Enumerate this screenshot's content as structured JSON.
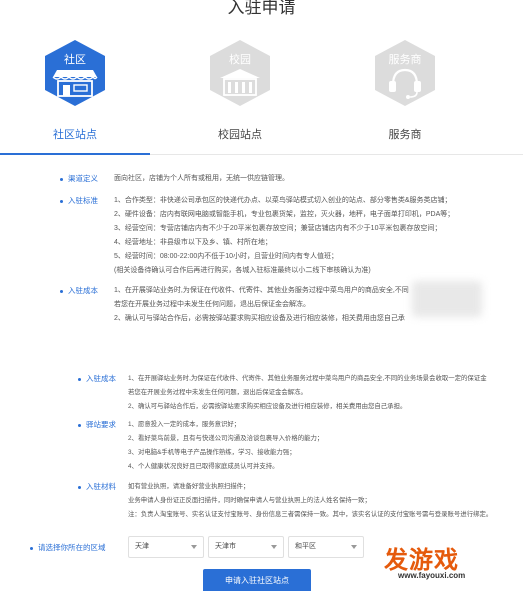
{
  "page": {
    "title": "入驻申请"
  },
  "tabs": [
    {
      "icon_text": "社区",
      "label": "社区站点",
      "active": true,
      "icon": "storefront-icon"
    },
    {
      "icon_text": "校园",
      "label": "校园站点",
      "active": false,
      "icon": "school-icon"
    },
    {
      "icon_text": "服务商",
      "label": "服务商",
      "active": false,
      "icon": "headset-icon"
    }
  ],
  "sections": {
    "channel": {
      "label": "渠道定义",
      "lines": [
        "面向社区，店铺为个人所有或租用，无统一供应链管理。"
      ]
    },
    "standard": {
      "label": "入驻标准",
      "lines": [
        "1、合作类型：非快递公司承包区的快递代办点、以菜鸟驿站模式切入创业的站点、部分零售类&服务类店铺；",
        "2、硬件设备：店内有联网电脑或智能手机，专业包裹货架，监控，灭火器，地秤，电子面单打印机，PDA等；",
        "3、经营空间：专营店铺店内有不少于20平米包裹存放空间；兼营店铺店内有不少于10平米包裹存放空间；",
        "4、经营地址：非县级市以下及乡、镇、村所在地；",
        "5、经营时间：08:00-22:00内不低于10小时，且营业时间内有专人值班；",
        "(相关设备待确认可合作后再进行购买，各城入驻标准最终以小二线下审核确认为准)"
      ]
    },
    "cost1": {
      "label": "入驻成本",
      "lines": [
        "1、在开展驿站业务时,为保证在代收件、代寄件、其他业务服务过程中菜鸟用户的商品安全,不同",
        "若您在开展业务过程中未发生任何问题，退出后保证金会解冻。",
        "2、确认可与驿站合作后，必需按驿站要求购买相应设备及进行相应装修，相关费用由您自己承"
      ]
    },
    "cost2": {
      "label": "入驻成本",
      "lines": [
        "1、在开展驿站业务时,为保证在代收件、代寄件、其他业务服务过程中菜鸟用户的商品安全,不同的业务场景会收取一定的保证金",
        "若您在开展业务过程中未发生任何问题，退出后保证金会解冻。",
        "2、确认可与驿站合作后，必需按驿站要求购买相应设备及进行相应装修，相关费用由您自己承担。"
      ]
    },
    "requirements": {
      "label": "驿站要求",
      "lines": [
        "1、愿意投入一定的成本，服务意识好；",
        "2、看好菜鸟前景，且有与快递公司沟通及洽谈包裹导入价格的能力；",
        "3、对电脑&手机等电子产品操作熟练，学习、接收能力强；",
        "4、个人健康状况良好且已取得家庭成员认可并支持。"
      ]
    },
    "materials": {
      "label": "入驻材料",
      "lines": [
        "如有营业执照，请准备好营业执照扫描件；",
        "业务申请人身份证正反面扫描件，同时确保申请人与营业执照上的法人姓名保持一致；",
        "注：负责人淘宝账号、实名认证支付宝账号、身份信息三者需保持一致。其中，该实名认证的支付宝账号需与登录账号进行绑定。"
      ]
    }
  },
  "region": {
    "label": "请选择你所在的区域",
    "province": "天津",
    "city": "天津市",
    "district": "和平区"
  },
  "submit_label": "申请入驻社区站点",
  "watermark": {
    "main": "发游戏",
    "url": "www.fayouxi.com"
  },
  "colors": {
    "accent": "#2a6fd6",
    "inactive_hex": "#dcdcdc",
    "watermark": "#e55a0c"
  }
}
